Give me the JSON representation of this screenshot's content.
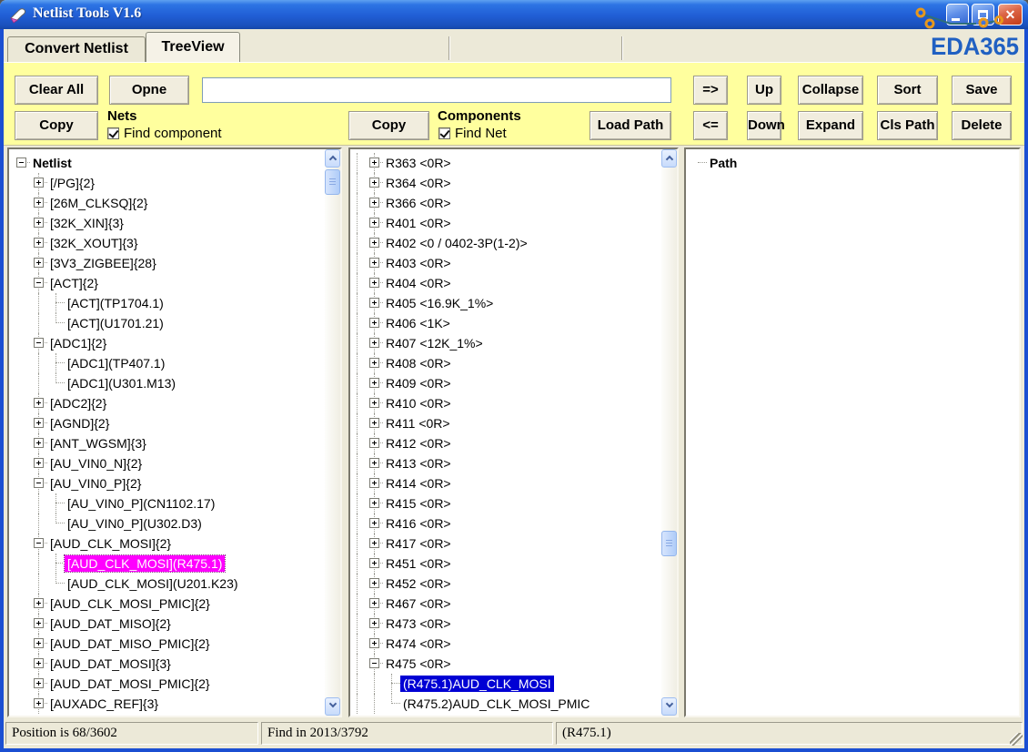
{
  "window": {
    "title": "Netlist Tools V1.6",
    "logo": "EDA365",
    "controls": {
      "minimize": "minimize",
      "maximize": "maximize",
      "close": "close"
    }
  },
  "tabs": {
    "items": [
      {
        "label": "Convert Netlist"
      },
      {
        "label": "TreeView"
      }
    ],
    "active_index": 1
  },
  "toolbar": {
    "buttons": {
      "clear_all": "Clear All",
      "opne": "Opne",
      "copy_nets": "Copy",
      "copy_components": "Copy",
      "load_path": "Load Path",
      "to_right": "=>",
      "to_left": "<=",
      "up": "Up",
      "down": "Down",
      "collapse": "Collapse",
      "expand": "Expand",
      "sort": "Sort",
      "cls_path": "Cls Path",
      "save": "Save",
      "delete": "Delete"
    },
    "search_input": {
      "value": "",
      "placeholder": ""
    },
    "nets_group": {
      "title": "Nets",
      "checkbox_label": "Find component",
      "checked": true
    },
    "components_group": {
      "title": "Components",
      "checkbox_label": "Find Net",
      "checked": true
    }
  },
  "nets_tree": {
    "items": [
      {
        "label": "Netlist",
        "level": 0,
        "box": "minus",
        "bold": true
      },
      {
        "label": "[/PG]{2}",
        "level": 1,
        "box": "plus"
      },
      {
        "label": "[26M_CLKSQ]{2}",
        "level": 1,
        "box": "plus"
      },
      {
        "label": "[32K_XIN]{3}",
        "level": 1,
        "box": "plus"
      },
      {
        "label": "[32K_XOUT]{3}",
        "level": 1,
        "box": "plus"
      },
      {
        "label": "[3V3_ZIGBEE]{28}",
        "level": 1,
        "box": "plus"
      },
      {
        "label": "[ACT]{2}",
        "level": 1,
        "box": "minus"
      },
      {
        "label": "[ACT](TP1704.1)",
        "level": 2
      },
      {
        "label": "[ACT](U1701.21)",
        "level": 2,
        "last": true
      },
      {
        "label": "[ADC1]{2}",
        "level": 1,
        "box": "minus"
      },
      {
        "label": "[ADC1](TP407.1)",
        "level": 2
      },
      {
        "label": "[ADC1](U301.M13)",
        "level": 2,
        "last": true
      },
      {
        "label": "[ADC2]{2}",
        "level": 1,
        "box": "plus"
      },
      {
        "label": "[AGND]{2}",
        "level": 1,
        "box": "plus"
      },
      {
        "label": "[ANT_WGSM]{3}",
        "level": 1,
        "box": "plus"
      },
      {
        "label": "[AU_VIN0_N]{2}",
        "level": 1,
        "box": "plus"
      },
      {
        "label": "[AU_VIN0_P]{2}",
        "level": 1,
        "box": "minus"
      },
      {
        "label": "[AU_VIN0_P](CN1102.17)",
        "level": 2
      },
      {
        "label": "[AU_VIN0_P](U302.D3)",
        "level": 2,
        "last": true
      },
      {
        "label": "[AUD_CLK_MOSI]{2}",
        "level": 1,
        "box": "minus"
      },
      {
        "label": "[AUD_CLK_MOSI](R475.1)",
        "level": 2,
        "hl": "magenta"
      },
      {
        "label": "[AUD_CLK_MOSI](U201.K23)",
        "level": 2,
        "last": true
      },
      {
        "label": "[AUD_CLK_MOSI_PMIC]{2}",
        "level": 1,
        "box": "plus"
      },
      {
        "label": "[AUD_DAT_MISO]{2}",
        "level": 1,
        "box": "plus"
      },
      {
        "label": "[AUD_DAT_MISO_PMIC]{2}",
        "level": 1,
        "box": "plus"
      },
      {
        "label": "[AUD_DAT_MOSI]{3}",
        "level": 1,
        "box": "plus"
      },
      {
        "label": "[AUD_DAT_MOSI_PMIC]{2}",
        "level": 1,
        "box": "plus"
      },
      {
        "label": "[AUXADC_REF]{3}",
        "level": 1,
        "box": "plus"
      }
    ]
  },
  "components_tree": {
    "items": [
      {
        "label": "R363 <0R>",
        "level": 1,
        "box": "plus"
      },
      {
        "label": "R364 <0R>",
        "level": 1,
        "box": "plus"
      },
      {
        "label": "R366 <0R>",
        "level": 1,
        "box": "plus"
      },
      {
        "label": "R401 <0R>",
        "level": 1,
        "box": "plus"
      },
      {
        "label": "R402 <0 / 0402-3P(1-2)>",
        "level": 1,
        "box": "plus"
      },
      {
        "label": "R403 <0R>",
        "level": 1,
        "box": "plus"
      },
      {
        "label": "R404 <0R>",
        "level": 1,
        "box": "plus"
      },
      {
        "label": "R405 <16.9K_1%>",
        "level": 1,
        "box": "plus"
      },
      {
        "label": "R406 <1K>",
        "level": 1,
        "box": "plus"
      },
      {
        "label": "R407 <12K_1%>",
        "level": 1,
        "box": "plus"
      },
      {
        "label": "R408 <0R>",
        "level": 1,
        "box": "plus"
      },
      {
        "label": "R409 <0R>",
        "level": 1,
        "box": "plus"
      },
      {
        "label": "R410 <0R>",
        "level": 1,
        "box": "plus"
      },
      {
        "label": "R411 <0R>",
        "level": 1,
        "box": "plus"
      },
      {
        "label": "R412 <0R>",
        "level": 1,
        "box": "plus"
      },
      {
        "label": "R413 <0R>",
        "level": 1,
        "box": "plus"
      },
      {
        "label": "R414 <0R>",
        "level": 1,
        "box": "plus"
      },
      {
        "label": "R415 <0R>",
        "level": 1,
        "box": "plus"
      },
      {
        "label": "R416 <0R>",
        "level": 1,
        "box": "plus"
      },
      {
        "label": "R417 <0R>",
        "level": 1,
        "box": "plus"
      },
      {
        "label": "R451 <0R>",
        "level": 1,
        "box": "plus"
      },
      {
        "label": "R452 <0R>",
        "level": 1,
        "box": "plus"
      },
      {
        "label": "R467 <0R>",
        "level": 1,
        "box": "plus"
      },
      {
        "label": "R473 <0R>",
        "level": 1,
        "box": "plus"
      },
      {
        "label": "R474 <0R>",
        "level": 1,
        "box": "plus"
      },
      {
        "label": "R475 <0R>",
        "level": 1,
        "box": "minus"
      },
      {
        "label": "(R475.1)AUD_CLK_MOSI",
        "level": 2,
        "hl": "blue"
      },
      {
        "label": "(R475.2)AUD_CLK_MOSI_PMIC",
        "level": 2,
        "last": true
      }
    ]
  },
  "path_tree": {
    "items": [
      {
        "label": "Path",
        "level": 0,
        "bold": true
      }
    ]
  },
  "status_bar": {
    "position": "Position is 68/3602",
    "find": "Find in 2013/3792",
    "selection": "(R475.1)"
  },
  "colors": {
    "toolbar_yellow": "#FFFF9E",
    "selection_magenta": "#FF00FF",
    "selection_blue": "#0000D4",
    "logo_blue": "#2060C2",
    "frame_blue": "#1B4FD2"
  }
}
